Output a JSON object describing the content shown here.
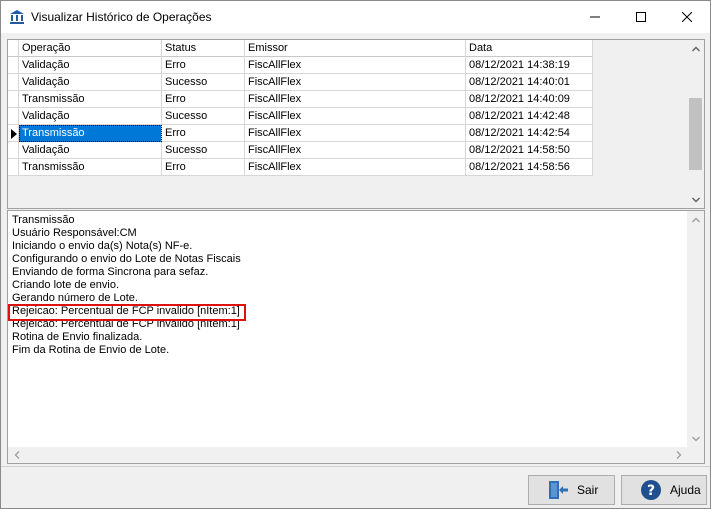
{
  "window": {
    "title": "Visualizar Histórico de Operações",
    "icon": "bank-icon"
  },
  "grid": {
    "columns": [
      "Operação",
      "Status",
      "Emissor",
      "Data"
    ],
    "rows": [
      {
        "operacao": "Validação",
        "status": "Erro",
        "emissor": "FiscAllFlex",
        "data": "08/12/2021 14:38:19"
      },
      {
        "operacao": "Validação",
        "status": "Sucesso",
        "emissor": "FiscAllFlex",
        "data": "08/12/2021 14:40:01"
      },
      {
        "operacao": "Transmissão",
        "status": "Erro",
        "emissor": "FiscAllFlex",
        "data": "08/12/2021 14:40:09"
      },
      {
        "operacao": "Validação",
        "status": "Sucesso",
        "emissor": "FiscAllFlex",
        "data": "08/12/2021 14:42:48"
      },
      {
        "operacao": "Transmissão",
        "status": "Erro",
        "emissor": "FiscAllFlex",
        "data": "08/12/2021 14:42:54"
      },
      {
        "operacao": "Validação",
        "status": "Sucesso",
        "emissor": "FiscAllFlex",
        "data": "08/12/2021 14:58:50"
      },
      {
        "operacao": "Transmissão",
        "status": "Erro",
        "emissor": "FiscAllFlex",
        "data": "08/12/2021 14:58:56"
      }
    ],
    "selected_row_index": 4
  },
  "log": {
    "lines": [
      "Transmissão",
      "Usuário Responsável:CM",
      "Iniciando o envio da(s) Nota(s) NF-e.",
      "Configurando o envio do Lote de Notas Fiscais",
      "Enviando de forma Sincrona para sefaz.",
      "Criando lote de envio.",
      "Gerando número de Lote.",
      "Rejeicao: Percentual de FCP invalido [nItem:1]",
      "Rejeicao: Percentual de FCP invalido [nItem:1]",
      "Rotina de Envio finalizada.",
      "Fim da Rotina de Envio de Lote."
    ],
    "highlighted_line_index": 7,
    "highlight_color": "#e01010"
  },
  "buttons": {
    "exit_label": "Sair",
    "exit_icon": "exit-door-icon",
    "help_label": "Ajuda",
    "help_icon": "help-question-icon"
  },
  "colors": {
    "selection": "#0078d7"
  }
}
